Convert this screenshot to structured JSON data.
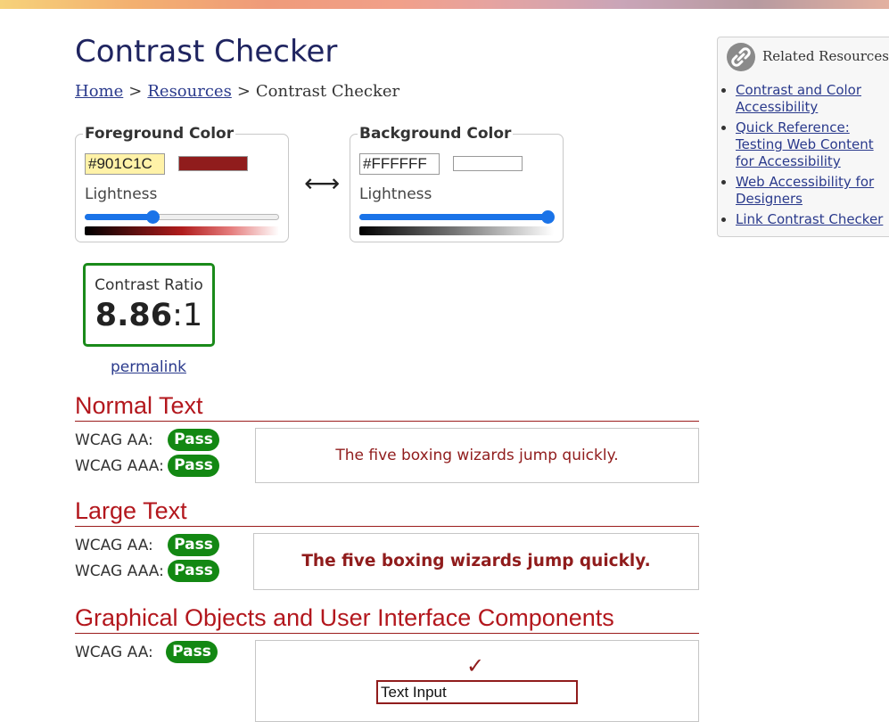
{
  "page": {
    "title": "Contrast Checker"
  },
  "breadcrumb": {
    "home": "Home",
    "sep1": ">",
    "resources": "Resources",
    "sep2": ">",
    "current": "Contrast Checker"
  },
  "foreground": {
    "legend": "Foreground Color",
    "hex": "#901C1C",
    "swatch_color": "#901C1C",
    "lightness_label": "Lightness",
    "lightness_value": 0.35
  },
  "background": {
    "legend": "Background Color",
    "hex": "#FFFFFF",
    "swatch_color": "#FFFFFF",
    "lightness_label": "Lightness",
    "lightness_value": 1.0
  },
  "swap": {
    "icon": "swap-arrows-icon",
    "glyph": "⟷"
  },
  "contrast": {
    "label": "Contrast Ratio",
    "ratio": "8.86",
    "suffix": ":1",
    "permalink": "permalink"
  },
  "normal_text": {
    "heading": "Normal Text",
    "aa_label": "WCAG AA:",
    "aa_result": "Pass",
    "aaa_label": "WCAG AAA:",
    "aaa_result": "Pass",
    "sample": "The five boxing wizards jump quickly."
  },
  "large_text": {
    "heading": "Large Text",
    "aa_label": "WCAG AA:",
    "aa_result": "Pass",
    "aaa_label": "WCAG AAA:",
    "aaa_result": "Pass",
    "sample": "The five boxing wizards jump quickly."
  },
  "graphical": {
    "heading": "Graphical Objects and User Interface Components",
    "aa_label": "WCAG AA:",
    "aa_result": "Pass",
    "check_glyph": "✓",
    "input_value": "Text Input"
  },
  "sidebar": {
    "title": "Related Resources",
    "icon": "link-icon",
    "links": [
      "Contrast and Color Accessibility",
      "Quick Reference: Testing Web Content for Accessibility",
      "Web Accessibility for Designers",
      "Link Contrast Checker"
    ]
  },
  "colors": {
    "title": "#1F2460",
    "link": "#2A3A8C",
    "section_heading": "#B3171D",
    "pass_badge": "#138813",
    "ratio_border": "#1A8A1A",
    "slider": "#1A73E8"
  }
}
